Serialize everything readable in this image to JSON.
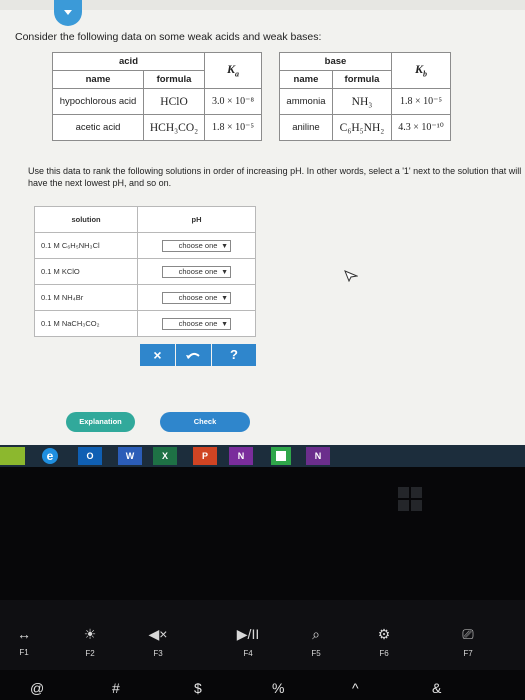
{
  "question": {
    "prompt": "Consider the following data on some weak acids and weak bases:",
    "acid_table": {
      "header": "acid",
      "col_name": "name",
      "col_formula": "formula",
      "col_k": "Ka",
      "rows": [
        {
          "name": "hypochlorous acid",
          "formula": "HClO",
          "k": "3.0 × 10⁻⁸"
        },
        {
          "name": "acetic acid",
          "formula": "HCH₃CO₂",
          "k": "1.8 × 10⁻⁵"
        }
      ]
    },
    "base_table": {
      "header": "base",
      "col_name": "name",
      "col_formula": "formula",
      "col_k": "Kb",
      "rows": [
        {
          "name": "ammonia",
          "formula": "NH₃",
          "k": "1.8 × 10⁻⁵"
        },
        {
          "name": "aniline",
          "formula": "C₆H₅NH₂",
          "k": "4.3 × 10⁻¹⁰"
        }
      ]
    },
    "instructions": "Use this data to rank the following solutions in order of increasing pH. In other words, select a '1' next to the solution that will have the next lowest pH, and so on.",
    "rank_table": {
      "col_solution": "solution",
      "col_ph": "pH",
      "rows": [
        {
          "solution": "0.1 M C₆H₅NH₃Cl",
          "choice": "choose one"
        },
        {
          "solution": "0.1 M KClO",
          "choice": "choose one"
        },
        {
          "solution": "0.1 M NH₄Br",
          "choice": "choose one"
        },
        {
          "solution": "0.1 M NaCH₃CO₂",
          "choice": "choose one"
        }
      ]
    }
  },
  "actions": {
    "clear_symbol": "×",
    "help_symbol": "?",
    "explanation_label": "Explanation",
    "check_label": "Check"
  },
  "taskbar": {
    "ie": "e",
    "outlook": "O",
    "word": "W",
    "excel": "X",
    "powerpoint": "P",
    "onenote": "N",
    "onenote2": "N"
  },
  "keyboard": {
    "fkeys": [
      {
        "label": "F1",
        "icon": "↔"
      },
      {
        "label": "F2",
        "icon": "☀"
      },
      {
        "label": "F3",
        "icon": "◀×"
      },
      {
        "label": "F4",
        "icon": "▶/II"
      },
      {
        "label": "F5",
        "icon": "⌕"
      },
      {
        "label": "F6",
        "icon": "⚙"
      },
      {
        "label": "F7",
        "icon": "⎚"
      }
    ],
    "numrow": [
      "@",
      "#",
      "$",
      "%",
      "^",
      "&"
    ]
  },
  "colors": {
    "accent_blue": "#2f86cc",
    "teal": "#31a99b",
    "screen_bg": "#f2f2ef",
    "taskbar_bg": "#1c2d3c"
  }
}
